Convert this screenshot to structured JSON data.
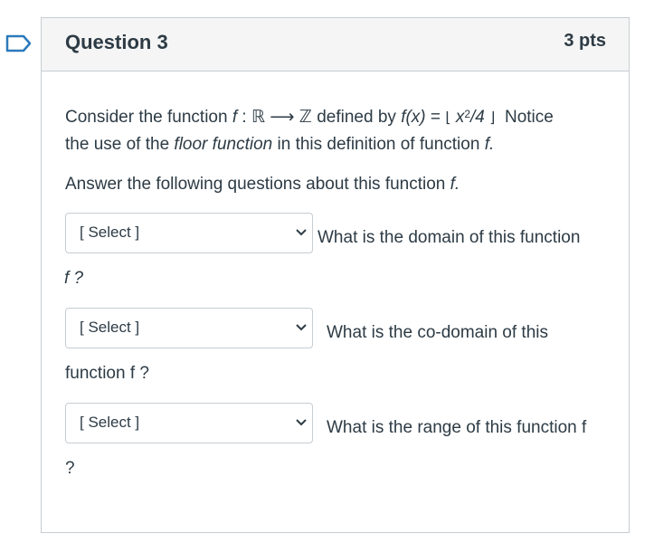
{
  "question": {
    "title": "Question 3",
    "points": "3 pts"
  },
  "intro": {
    "line1_a": "Consider the function ",
    "line1_f": "f",
    "line1_b": " : ℝ ⟶ ℤ defined by ",
    "line1_fx": "f(x)",
    "line1_eq": " = ",
    "floor_l": "⌊",
    "line1_x": "x",
    "line1_exp": "2",
    "line1_div": "/4",
    "floor_r": "⌋",
    "line1_notice": "Notice",
    "line2_a": "the use of the ",
    "line2_floor": "floor function",
    "line2_b": " in this definition of function ",
    "line2_f": "f."
  },
  "instruction": {
    "text": "Answer the following questions about this function ",
    "f": "f."
  },
  "questions": [
    {
      "select": "[ Select ]",
      "text": "What is the domain of this function",
      "cont": "f ?"
    },
    {
      "select": "[ Select ]",
      "text": "What is the co-domain of this",
      "cont": "function f ?"
    },
    {
      "select": "[ Select ]",
      "text": "What is the range of this function f",
      "cont": "?"
    }
  ],
  "colors": {
    "accent": "#2b7abc",
    "text": "#2d3b45",
    "border": "#c7cdd1",
    "header_bg": "#f5f5f5"
  }
}
